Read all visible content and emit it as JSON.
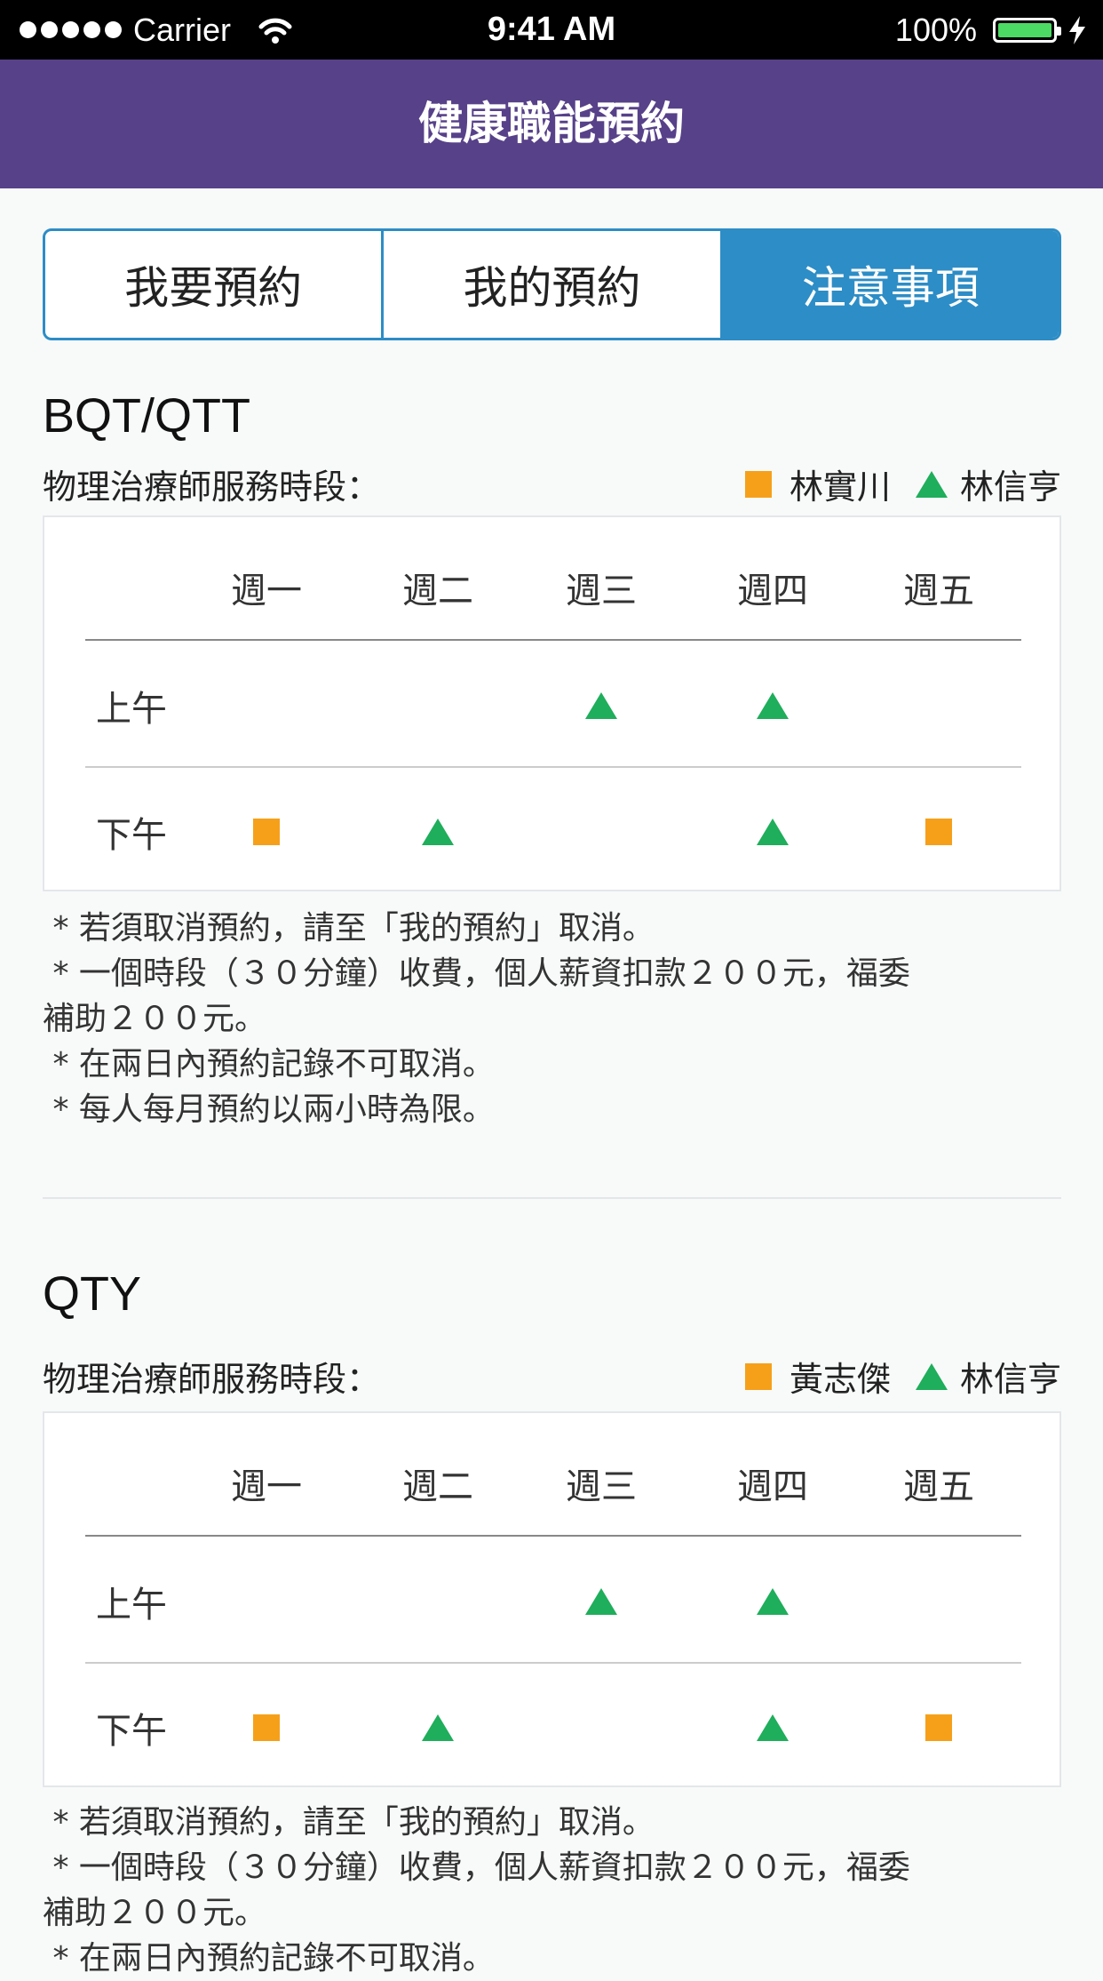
{
  "status_bar": {
    "carrier": "Carrier",
    "time": "9:41 AM",
    "battery": "100%"
  },
  "nav": {
    "title": "健康職能預約"
  },
  "tabs": [
    {
      "label": "我要預約",
      "active": false
    },
    {
      "label": "我的預約",
      "active": false
    },
    {
      "label": "注意事項",
      "active": true
    }
  ],
  "sections": [
    {
      "title": "BQT/QTT",
      "schedule_label": "物理治療師服務時段：",
      "legend": {
        "square": "林實川",
        "triangle": "林信亨"
      },
      "days": [
        "週一",
        "週二",
        "週三",
        "週四",
        "週五"
      ],
      "rows": [
        {
          "label": "上午",
          "marks": [
            "",
            "",
            "triangle",
            "triangle",
            ""
          ]
        },
        {
          "label": "下午",
          "marks": [
            "square",
            "triangle",
            "",
            "triangle",
            "square"
          ]
        }
      ],
      "notes": [
        " * 若須取消預約，請至「我的預約」取消。",
        " * 一個時段（３０分鐘）收費，個人薪資扣款２００元，福委",
        "補助２００元。",
        " * 在兩日內預約記錄不可取消。",
        " * 每人每月預約以兩小時為限。"
      ]
    },
    {
      "title": "QTY",
      "schedule_label": "物理治療師服務時段：",
      "legend": {
        "square": "黃志傑",
        "triangle": "林信亨"
      },
      "days": [
        "週一",
        "週二",
        "週三",
        "週四",
        "週五"
      ],
      "rows": [
        {
          "label": "上午",
          "marks": [
            "",
            "",
            "triangle",
            "triangle",
            ""
          ]
        },
        {
          "label": "下午",
          "marks": [
            "square",
            "triangle",
            "",
            "triangle",
            "square"
          ]
        }
      ],
      "notes": [
        " * 若須取消預約，請至「我的預約」取消。",
        " * 一個時段（３０分鐘）收費，個人薪資扣款２００元，福委",
        "補助２００元。",
        " * 在兩日內預約記錄不可取消。"
      ]
    }
  ],
  "colors": {
    "nav_bg": "#574189",
    "accent": "#2d8dc6",
    "square_marker": "#f6a01a",
    "triangle_marker": "#1fae5b"
  }
}
